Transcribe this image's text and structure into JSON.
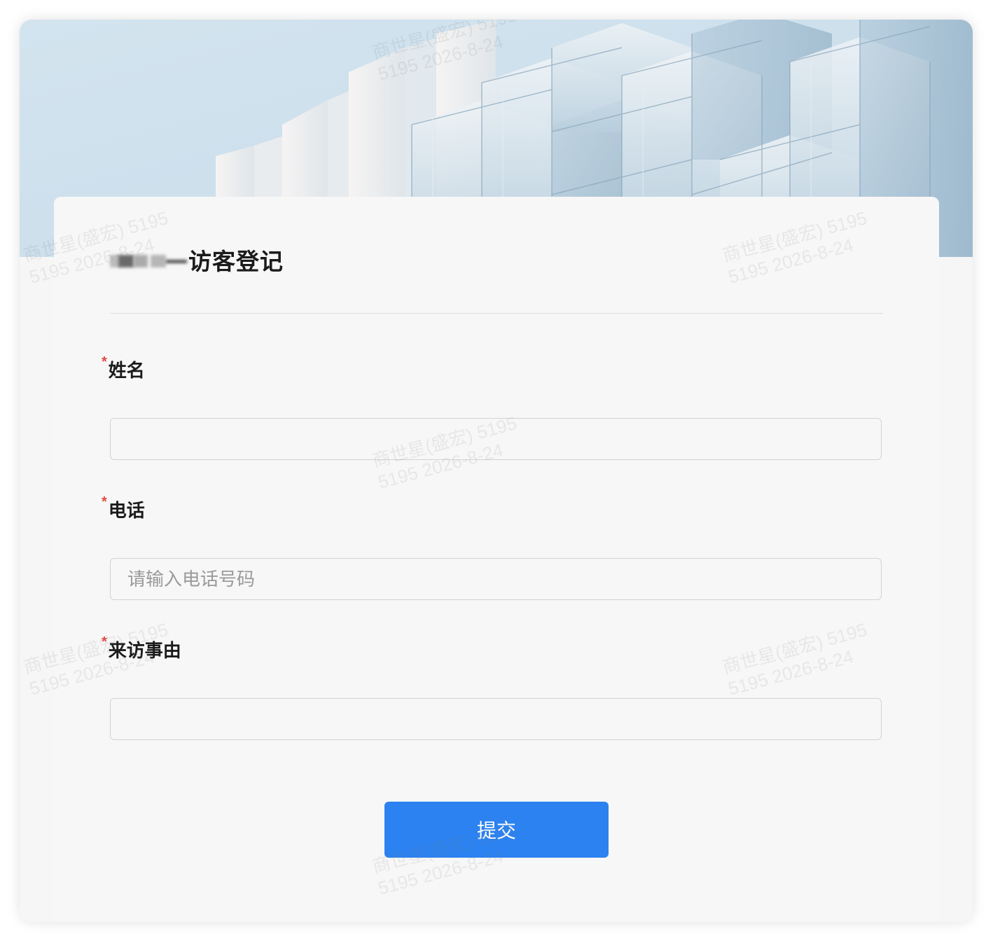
{
  "form": {
    "title": "访客登记",
    "fields": [
      {
        "label": "姓名",
        "required_mark": "*",
        "value": "",
        "placeholder": ""
      },
      {
        "label": "电话",
        "required_mark": "*",
        "value": "",
        "placeholder": "请输入电话号码"
      },
      {
        "label": "来访事由",
        "required_mark": "*",
        "value": "",
        "placeholder": ""
      }
    ],
    "submit_label": "提交"
  },
  "watermark": {
    "line1": "商世星(盛宏) 5195",
    "line2": "5195 2026-8-24"
  },
  "colors": {
    "accent": "#2b82f0",
    "required": "#e5483e"
  }
}
